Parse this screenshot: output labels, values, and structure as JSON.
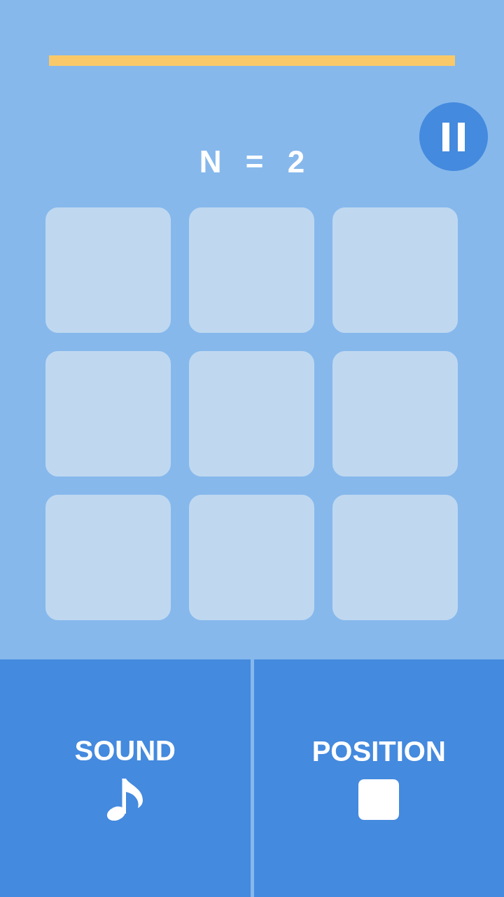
{
  "n_label": "N = 2",
  "grid": {
    "cells": [
      {
        "lit": false
      },
      {
        "lit": false
      },
      {
        "lit": false
      },
      {
        "lit": false
      },
      {
        "lit": false
      },
      {
        "lit": false
      },
      {
        "lit": false
      },
      {
        "lit": false
      },
      {
        "lit": false
      }
    ]
  },
  "buttons": [
    {
      "label": "SOUND",
      "kind": "sound"
    },
    {
      "label": "POSITION",
      "kind": "position"
    }
  ]
}
